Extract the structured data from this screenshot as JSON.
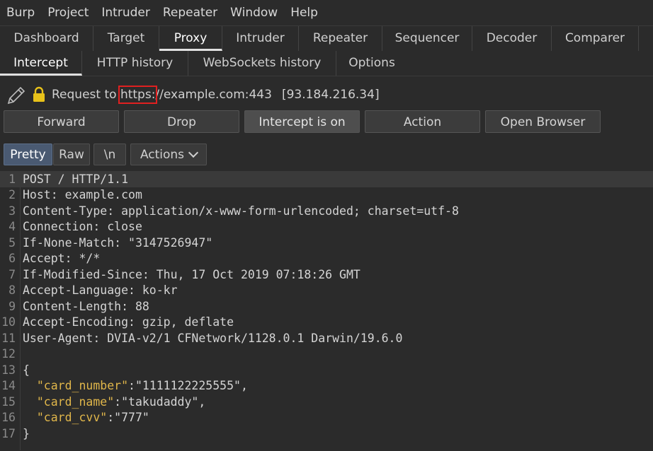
{
  "menu": [
    "Burp",
    "Project",
    "Intruder",
    "Repeater",
    "Window",
    "Help"
  ],
  "main_tabs": [
    "Dashboard",
    "Target",
    "Proxy",
    "Intruder",
    "Repeater",
    "Sequencer",
    "Decoder",
    "Comparer"
  ],
  "main_tab_active": "Proxy",
  "sub_tabs": [
    "Intercept",
    "HTTP history",
    "WebSockets history",
    "Options"
  ],
  "sub_tab_active": "Intercept",
  "request": {
    "prefix": "Request to ",
    "scheme": "https:",
    "rest": "//example.com:443",
    "ip": "[93.184.216.34]"
  },
  "buttons": {
    "forward": "Forward",
    "drop": "Drop",
    "intercept": "Intercept is on",
    "action": "Action",
    "open_browser": "Open Browser"
  },
  "view": {
    "pretty": "Pretty",
    "raw": "Raw",
    "newline": "\\n",
    "actions": "Actions"
  },
  "editor_lines": [
    {
      "n": "1",
      "text": "POST / HTTP/1.1"
    },
    {
      "n": "2",
      "text": "Host: example.com"
    },
    {
      "n": "3",
      "text": "Content-Type: application/x-www-form-urlencoded; charset=utf-8"
    },
    {
      "n": "4",
      "text": "Connection: close"
    },
    {
      "n": "5",
      "text": "If-None-Match: \"3147526947\""
    },
    {
      "n": "6",
      "text": "Accept: */*"
    },
    {
      "n": "7",
      "text": "If-Modified-Since: Thu, 17 Oct 2019 07:18:26 GMT"
    },
    {
      "n": "8",
      "text": "Accept-Language: ko-kr"
    },
    {
      "n": "9",
      "text": "Content-Length: 88"
    },
    {
      "n": "10",
      "text": "Accept-Encoding: gzip, deflate"
    },
    {
      "n": "11",
      "text": "User-Agent: DVIA-v2/1 CFNetwork/1128.0.1 Darwin/19.6.0"
    },
    {
      "n": "12",
      "text": ""
    },
    {
      "n": "13",
      "text": "{"
    },
    {
      "n": "14",
      "key": "\"card_number\"",
      "val": ":\"1111122225555\","
    },
    {
      "n": "15",
      "key": "\"card_name\"",
      "val": ":\"takudaddy\","
    },
    {
      "n": "16",
      "key": "\"card_cvv\"",
      "val": ":\"777\""
    },
    {
      "n": "17",
      "text": "}"
    }
  ],
  "colors": {
    "background": "#2b2b2b",
    "json_key": "#e0b64a",
    "highlight_box": "#e02020",
    "active_view": "#4a5a72"
  },
  "icons": [
    "pencil-icon",
    "lock-icon",
    "chevron-down-icon"
  ]
}
